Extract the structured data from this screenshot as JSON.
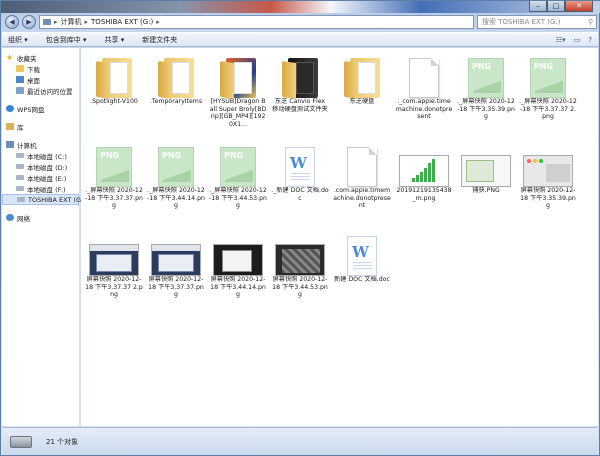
{
  "address": {
    "back": "◀",
    "forward": "▶",
    "crumbs": [
      "计算机",
      "TOSHIBA EXT (G:)"
    ],
    "search_placeholder": "搜索 TOSHIBA EXT (G:)"
  },
  "toolbar": {
    "organize": "组织 ▾",
    "include": "包含到库中 ▾",
    "share": "共享 ▾",
    "new_folder": "新建文件夹"
  },
  "nav": {
    "favorites": "收藏夹",
    "downloads": "下载",
    "desktop": "桌面",
    "recent": "最近访问的位置",
    "wps": "WPS网盘",
    "library": "库",
    "computer": "计算机",
    "drive_c": "本地磁盘 (C:)",
    "drive_d": "本地磁盘 (D:)",
    "drive_e": "本地磁盘 (E:)",
    "drive_f": "本地磁盘 (F:)",
    "drive_g": "TOSHIBA EXT (G:)",
    "network": "网络"
  },
  "files": [
    {
      "name": ".Spotlight-V100",
      "kind": "folder"
    },
    {
      "name": ".TemporaryItems",
      "kind": "folder"
    },
    {
      "name": "[HYSUB]Dragon Ball Super Broly[BDrip][GB_MP4][1920X1...",
      "kind": "folder-movie"
    },
    {
      "name": "东芝 Canvio Flex 移动硬盘测试文件夹",
      "kind": "folder-dark"
    },
    {
      "name": "东芝硬盘",
      "kind": "folder"
    },
    {
      "name": "._com.apple.timemachine.donotpresent",
      "kind": "doc"
    },
    {
      "name": "._屏幕快照 2020-12-18 下午3.35.39.png",
      "kind": "png"
    },
    {
      "name": "._屏幕快照 2020-12-18 下午3.37.37 2.png",
      "kind": "png"
    },
    {
      "name": "._屏幕快照 2020-12-18 下午3.37.37.png",
      "kind": "png"
    },
    {
      "name": "._屏幕快照 2020-12-18 下午3.44.14.png",
      "kind": "png"
    },
    {
      "name": "._屏幕快照 2020-12-18 下午3.44.53.png",
      "kind": "png"
    },
    {
      "name": "._新建 DOC 文档.doc",
      "kind": "word"
    },
    {
      "name": ".com.apple.timemachine.donotpresent",
      "kind": "doc"
    },
    {
      "name": "20191219135438_m.png",
      "kind": "shot-chart"
    },
    {
      "name": "捕获.PNG",
      "kind": "shot-dialog"
    },
    {
      "name": "屏幕快照 2020-12-18 下午3.35.39.png",
      "kind": "shot-mac"
    },
    {
      "name": "屏幕快照 2020-12-18 下午3.37.37 2.png",
      "kind": "shot-desk"
    },
    {
      "name": "屏幕快照 2020-12-18 下午3.37.37.png",
      "kind": "shot-desk"
    },
    {
      "name": "屏幕快照 2020-12-18 下午3.44.14.png",
      "kind": "shot-dark"
    },
    {
      "name": "屏幕快照 2020-12-18 下午3.44.53.png",
      "kind": "shot-dark2"
    },
    {
      "name": "新建 DOC 文档.doc",
      "kind": "word"
    }
  ],
  "status": {
    "count": "21 个对象"
  }
}
